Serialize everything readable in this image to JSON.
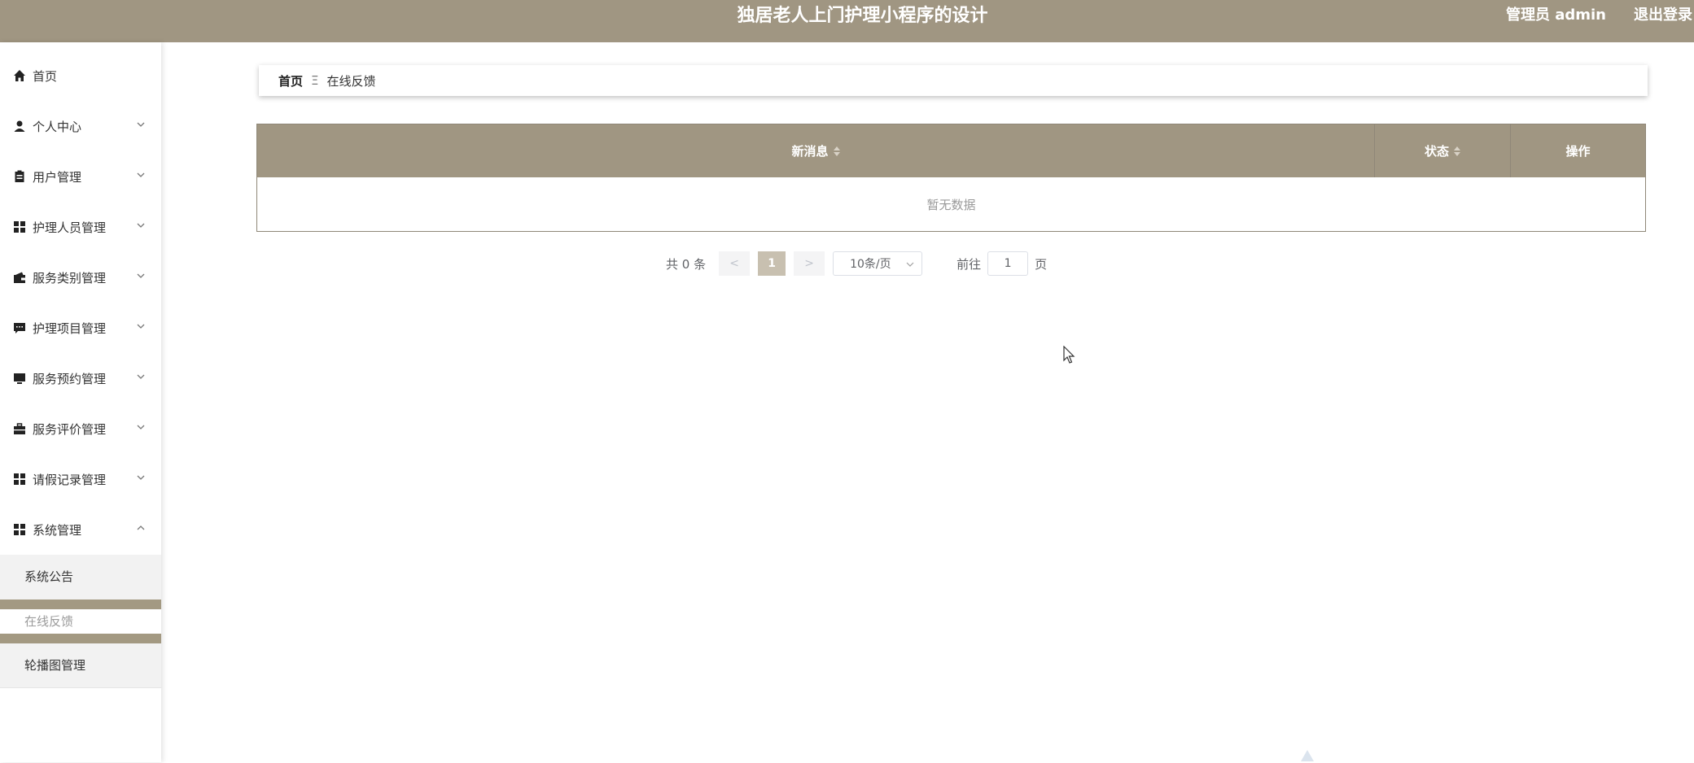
{
  "header": {
    "title": "独居老人上门护理小程序的设计",
    "user": "管理员 admin",
    "logout": "退出登录"
  },
  "sidebar": {
    "items": [
      {
        "label": "首页",
        "icon": "home-icon"
      },
      {
        "label": "个人中心",
        "icon": "user-icon"
      },
      {
        "label": "用户管理",
        "icon": "clipboard-icon"
      },
      {
        "label": "护理人员管理",
        "icon": "grid-icon"
      },
      {
        "label": "服务类别管理",
        "icon": "wallet-icon"
      },
      {
        "label": "护理项目管理",
        "icon": "message-icon"
      },
      {
        "label": "服务预约管理",
        "icon": "monitor-icon"
      },
      {
        "label": "服务评价管理",
        "icon": "briefcase-icon"
      },
      {
        "label": "请假记录管理",
        "icon": "grid-icon"
      },
      {
        "label": "系统管理",
        "icon": "grid-icon"
      }
    ],
    "sub_items": [
      {
        "label": "系统公告"
      },
      {
        "label": "在线反馈"
      },
      {
        "label": "轮播图管理"
      }
    ]
  },
  "breadcrumb": {
    "home": "首页",
    "separator": "Ξ",
    "current": "在线反馈"
  },
  "table": {
    "columns": [
      "新消息",
      "状态",
      "操作"
    ],
    "empty_text": "暂无数据"
  },
  "pagination": {
    "total_text": "共 0 条",
    "prev": "<",
    "page": "1",
    "next": ">",
    "page_size": "10条/页",
    "goto_label": "前往",
    "goto_value": "1",
    "page_suffix": "页"
  },
  "colors": {
    "brand": "#a09682",
    "active_page": "#c8c0b0"
  }
}
